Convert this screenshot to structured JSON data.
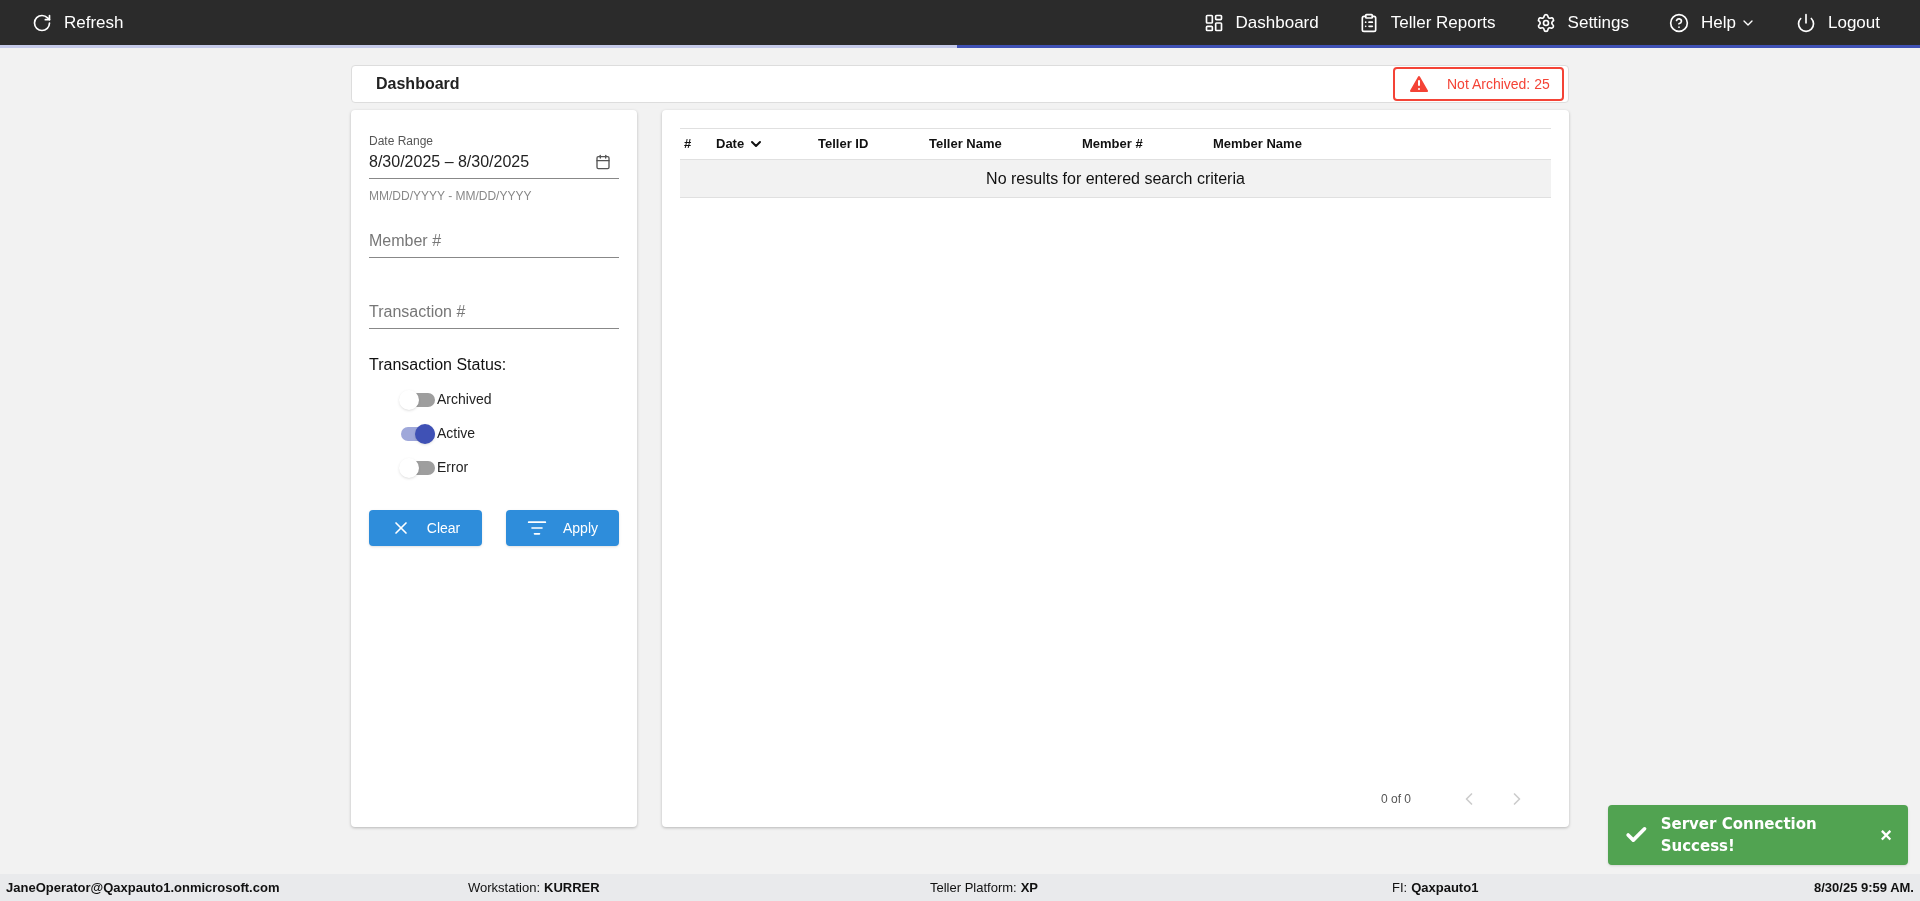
{
  "top_bar": {
    "refresh": "Refresh",
    "nav": [
      {
        "kind": "dashboard",
        "label": "Dashboard"
      },
      {
        "kind": "reports",
        "label": "Teller Reports"
      },
      {
        "kind": "settings",
        "label": "Settings"
      },
      {
        "kind": "help",
        "label": "Help"
      },
      {
        "kind": "logout",
        "label": "Logout"
      }
    ]
  },
  "header": {
    "title": "Dashboard",
    "alert": "Not Archived: 25"
  },
  "filters": {
    "date_range": {
      "label": "Date Range",
      "value": "8/30/2025 – 8/30/2025",
      "hint": "MM/DD/YYYY - MM/DD/YYYY"
    },
    "member": {
      "placeholder": "Member #"
    },
    "transaction": {
      "placeholder": "Transaction #"
    },
    "status_label": "Transaction Status:",
    "statuses": [
      {
        "label": "Archived",
        "on": false
      },
      {
        "label": "Active",
        "on": true
      },
      {
        "label": "Error",
        "on": false
      }
    ],
    "buttons": [
      {
        "kind": "clear",
        "label": "Clear"
      },
      {
        "kind": "apply",
        "label": "Apply"
      }
    ]
  },
  "table": {
    "columns": [
      "#",
      "Date",
      "Teller ID",
      "Teller Name",
      "Member #",
      "Member Name"
    ],
    "empty": "No results for entered search criteria",
    "pagination": "0 of 0"
  },
  "toast": {
    "message": "Server Connection Success!",
    "close": "×"
  },
  "status_bar": {
    "user": "JaneOperator@Qaxpauto1.onmicrosoft.com",
    "workstation_label": "Workstation:",
    "workstation": "KURRER",
    "platform_label": "Teller Platform:",
    "platform": "XP",
    "fi_label": "FI:",
    "fi": "Qaxpauto1",
    "datetime": "8/30/25 9:59 AM."
  }
}
